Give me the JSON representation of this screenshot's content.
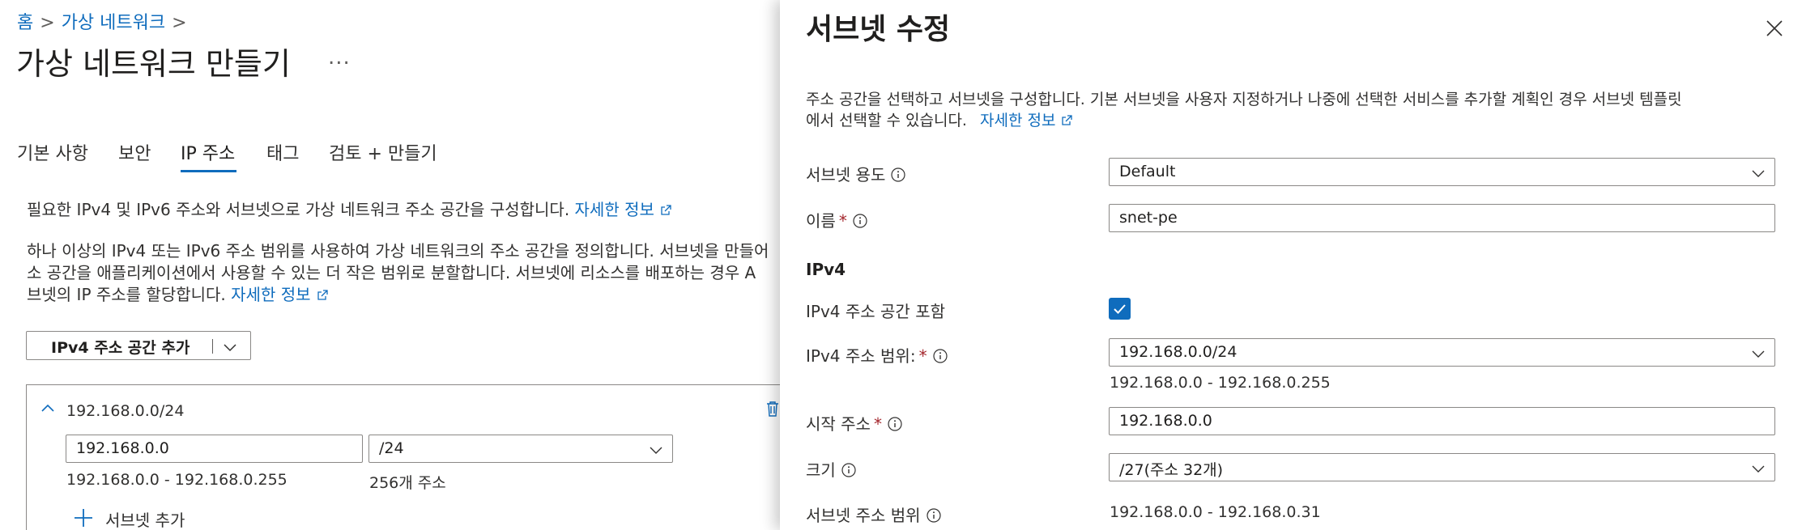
{
  "breadcrumb": {
    "home": "홈",
    "current": "가상 네트워크"
  },
  "page": {
    "title": "가상 네트워크 만들기",
    "more": "..."
  },
  "tabs": [
    "기본 사항",
    "보안",
    "IP 주소",
    "태그",
    "검토 + 만들기"
  ],
  "intro": {
    "line1": "필요한 IPv4 및 IPv6 주소와 서브넷으로 가상 네트워크 주소 공간을 구성합니다.",
    "learn_more": "자세한 정보",
    "para_line1": "하나 이상의 IPv4 또는 IPv6 주소 범위를 사용하여 가상 네트워크의 주소 공간을 정의합니다. 서브넷을 만들어",
    "para_line2": "소 공간을 애플리케이션에서 사용할 수 있는 더 작은 범위로 분할합니다. 서브넷에 리소스를 배포하는 경우 A",
    "para_line3": "브넷의 IP 주소를 할당합니다."
  },
  "add_space_button": "IPv4 주소 공간 추가",
  "address_space": {
    "cidr": "192.168.0.0/24",
    "start": "192.168.0.0",
    "prefix": "/24",
    "range": "192.168.0.0 - 192.168.0.255",
    "count": "256개 주소",
    "add_subnet": "서브넷 추가"
  },
  "panel": {
    "title": "서브넷 수정",
    "desc_line1": "주소 공간을 선택하고 서브넷을 구성합니다. 기본 서브넷을 사용자 지정하거나 나중에 선택한 서비스를 추가할 계획인 경우 서브넷 템플릿",
    "desc_line2": "에서 선택할 수 있습니다.",
    "learn_more": "자세한 정보",
    "purpose_label": "서브넷 용도",
    "purpose_value": "Default",
    "name_label": "이름",
    "name_value": "snet-pe",
    "ipv4_heading": "IPv4",
    "include_label": "IPv4 주소 공간 포함",
    "include_checked": true,
    "range_label": "IPv4 주소 범위:",
    "range_value": "192.168.0.0/24",
    "range_text": "192.168.0.0 - 192.168.0.255",
    "start_label": "시작 주소",
    "start_value": "192.168.0.0",
    "size_label": "크기",
    "size_value": "/27(주소 32개)",
    "subnet_range_label": "서브넷 주소 범위",
    "subnet_range_value": "192.168.0.0 - 192.168.0.31",
    "required_mark": "*"
  },
  "colors": {
    "accent": "#0f6cbd",
    "required": "#a4262c",
    "text": "#323130"
  }
}
